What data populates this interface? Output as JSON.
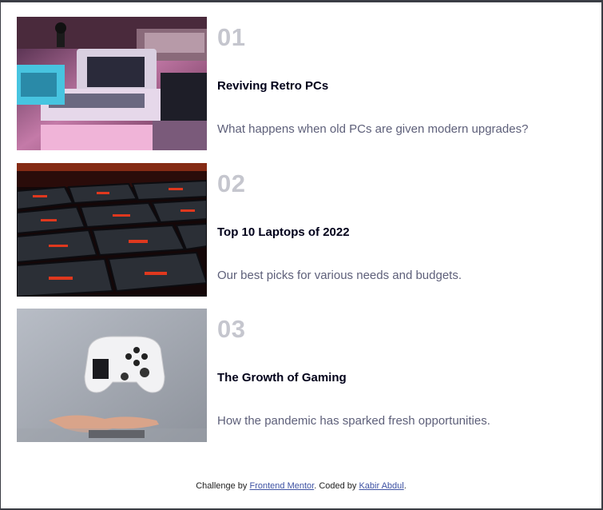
{
  "articles": [
    {
      "number": "01",
      "title": "Reviving Retro PCs",
      "description": "What happens when old PCs are given modern upgrades?",
      "image_subject": "retro-computers"
    },
    {
      "number": "02",
      "title": "Top 10 Laptops of 2022",
      "description": "Our best picks for various needs and budgets.",
      "image_subject": "laptop-keyboard"
    },
    {
      "number": "03",
      "title": "The Growth of Gaming",
      "description": "How the pandemic has sparked fresh opportunities.",
      "image_subject": "game-controller"
    }
  ],
  "footer": {
    "prefix": "Challenge by",
    "link1": "Frontend Mentor",
    "middle": ". Coded by",
    "link2": "Kabir Abdul",
    "suffix": "."
  },
  "colors": {
    "number": "#c5c6ce",
    "title": "#00001a",
    "description": "#5e607a",
    "link": "#3e52a3"
  }
}
